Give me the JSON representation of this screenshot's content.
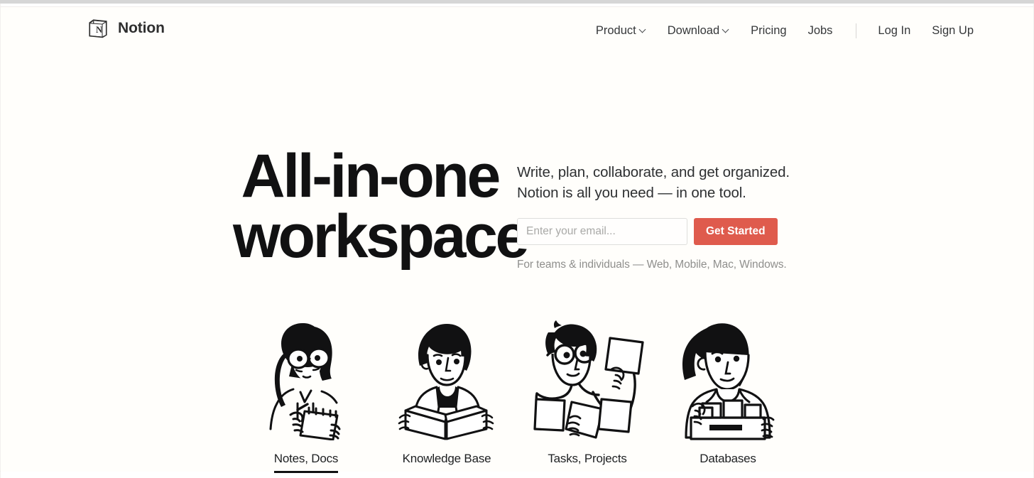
{
  "browser": {
    "background_color": "#fffefb",
    "chrome_strip_color": "#d6d6d6"
  },
  "header": {
    "brand": {
      "name": "Notion",
      "logo_icon": "notion-cube-icon"
    },
    "nav": [
      {
        "label": "Product",
        "has_dropdown": true,
        "icon": "chevron-down-icon"
      },
      {
        "label": "Download",
        "has_dropdown": true,
        "icon": "chevron-down-icon"
      },
      {
        "label": "Pricing",
        "has_dropdown": false
      },
      {
        "label": "Jobs",
        "has_dropdown": false
      }
    ],
    "account": [
      {
        "label": "Log In"
      },
      {
        "label": "Sign Up"
      }
    ]
  },
  "hero": {
    "headline_line1": "All-in-one",
    "headline_line2": "workspace",
    "subhead_line1": "Write, plan, collaborate, and get organized.",
    "subhead_line2": "Notion is all you need — in one tool.",
    "email_placeholder": "Enter your email...",
    "email_value": "",
    "cta_label": "Get Started",
    "cta_color": "#df5b4d",
    "platforms": "For teams & individuals — Web, Mobile, Mac, Windows."
  },
  "features": [
    {
      "label": "Notes, Docs",
      "icon": "woman-writing-notebook-illustration",
      "active": true
    },
    {
      "label": "Knowledge Base",
      "icon": "person-reading-book-illustration",
      "active": false
    },
    {
      "label": "Tasks, Projects",
      "icon": "person-holding-cards-illustration",
      "active": false
    },
    {
      "label": "Databases",
      "icon": "woman-file-drawer-illustration",
      "active": false
    }
  ]
}
